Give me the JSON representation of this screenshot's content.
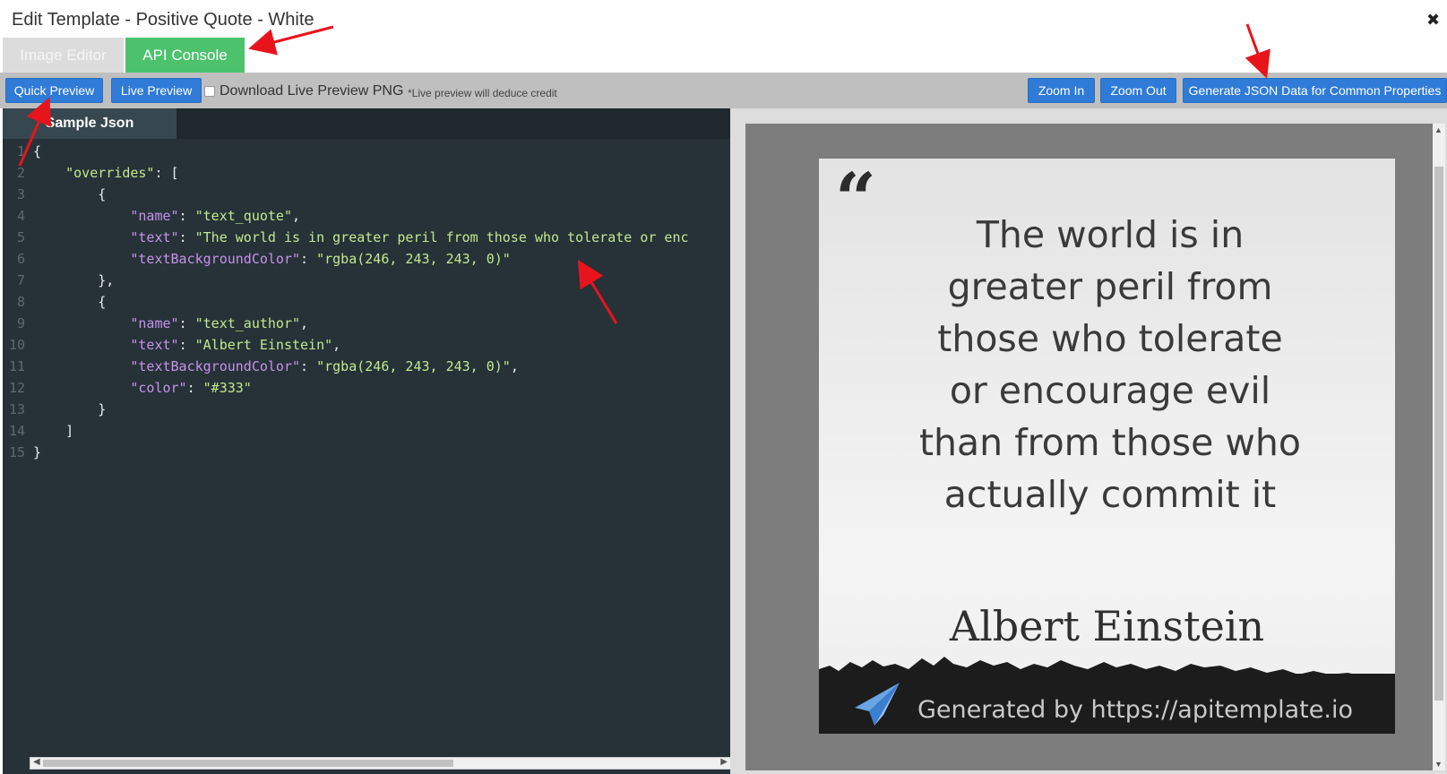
{
  "window": {
    "title": "Edit Template - Positive Quote - White",
    "close_glyph": "✖"
  },
  "tabs": [
    {
      "label": "Image Editor",
      "active": false
    },
    {
      "label": "API Console",
      "active": true
    }
  ],
  "toolbar": {
    "quick_preview": "Quick Preview",
    "live_preview": "Live Preview",
    "download_label": "Download Live Preview PNG",
    "download_checked": false,
    "note": "*Live preview will deduce credit",
    "zoom_in": "Zoom In",
    "zoom_out": "Zoom Out",
    "generate_json": "Generate JSON Data for Common Properties"
  },
  "editor": {
    "tab_label": "Sample Json",
    "lines": [
      {
        "num": "1",
        "parts": [
          {
            "t": "{",
            "c": "p"
          }
        ]
      },
      {
        "num": "2",
        "parts": [
          {
            "t": "    ",
            "c": "p"
          },
          {
            "t": "\"overrides\"",
            "c": "s"
          },
          {
            "t": ": [",
            "c": "p"
          }
        ]
      },
      {
        "num": "3",
        "parts": [
          {
            "t": "        {",
            "c": "p"
          }
        ]
      },
      {
        "num": "4",
        "parts": [
          {
            "t": "            ",
            "c": "p"
          },
          {
            "t": "\"name\"",
            "c": "k"
          },
          {
            "t": ": ",
            "c": "p"
          },
          {
            "t": "\"text_quote\"",
            "c": "s"
          },
          {
            "t": ",",
            "c": "p"
          }
        ]
      },
      {
        "num": "5",
        "parts": [
          {
            "t": "            ",
            "c": "p"
          },
          {
            "t": "\"text\"",
            "c": "k"
          },
          {
            "t": ": ",
            "c": "p"
          },
          {
            "t": "\"The world is in greater peril from those who tolerate or enc",
            "c": "s"
          }
        ]
      },
      {
        "num": "6",
        "parts": [
          {
            "t": "            ",
            "c": "p"
          },
          {
            "t": "\"textBackgroundColor\"",
            "c": "k"
          },
          {
            "t": ": ",
            "c": "p"
          },
          {
            "t": "\"rgba(246, 243, 243, 0)\"",
            "c": "s"
          }
        ]
      },
      {
        "num": "7",
        "parts": [
          {
            "t": "        },",
            "c": "p"
          }
        ]
      },
      {
        "num": "8",
        "parts": [
          {
            "t": "        {",
            "c": "p"
          }
        ]
      },
      {
        "num": "9",
        "parts": [
          {
            "t": "            ",
            "c": "p"
          },
          {
            "t": "\"name\"",
            "c": "k"
          },
          {
            "t": ": ",
            "c": "p"
          },
          {
            "t": "\"text_author\"",
            "c": "s"
          },
          {
            "t": ",",
            "c": "p"
          }
        ]
      },
      {
        "num": "10",
        "parts": [
          {
            "t": "            ",
            "c": "p"
          },
          {
            "t": "\"text\"",
            "c": "k"
          },
          {
            "t": ": ",
            "c": "p"
          },
          {
            "t": "\"Albert Einstein\"",
            "c": "s"
          },
          {
            "t": ",",
            "c": "p"
          }
        ]
      },
      {
        "num": "11",
        "parts": [
          {
            "t": "            ",
            "c": "p"
          },
          {
            "t": "\"textBackgroundColor\"",
            "c": "k"
          },
          {
            "t": ": ",
            "c": "p"
          },
          {
            "t": "\"rgba(246, 243, 243, 0)\"",
            "c": "s"
          },
          {
            "t": ",",
            "c": "p"
          }
        ]
      },
      {
        "num": "12",
        "parts": [
          {
            "t": "            ",
            "c": "p"
          },
          {
            "t": "\"color\"",
            "c": "k"
          },
          {
            "t": ": ",
            "c": "p"
          },
          {
            "t": "\"#333\"",
            "c": "s"
          }
        ]
      },
      {
        "num": "13",
        "parts": [
          {
            "t": "        }",
            "c": "p"
          }
        ]
      },
      {
        "num": "14",
        "parts": [
          {
            "t": "    ]",
            "c": "p"
          }
        ]
      },
      {
        "num": "15",
        "parts": [
          {
            "t": "}",
            "c": "p"
          }
        ]
      }
    ]
  },
  "preview": {
    "quote_lines": [
      "The world is in",
      "greater peril from",
      "those who tolerate",
      "or encourage evil",
      "than from those who",
      "actually commit it"
    ],
    "author": "Albert Einstein",
    "footer_text": "Generated by https://apitemplate.io",
    "quote_mark": "“"
  },
  "colors": {
    "accent_green": "#4cc26d",
    "button_blue": "#2f7bd7",
    "editor_bg": "#263238",
    "annotation_red": "#e8141c"
  },
  "icons": {
    "close": "close-icon",
    "plane": "paper-plane-icon",
    "annotation": "red-arrow-annotation"
  }
}
